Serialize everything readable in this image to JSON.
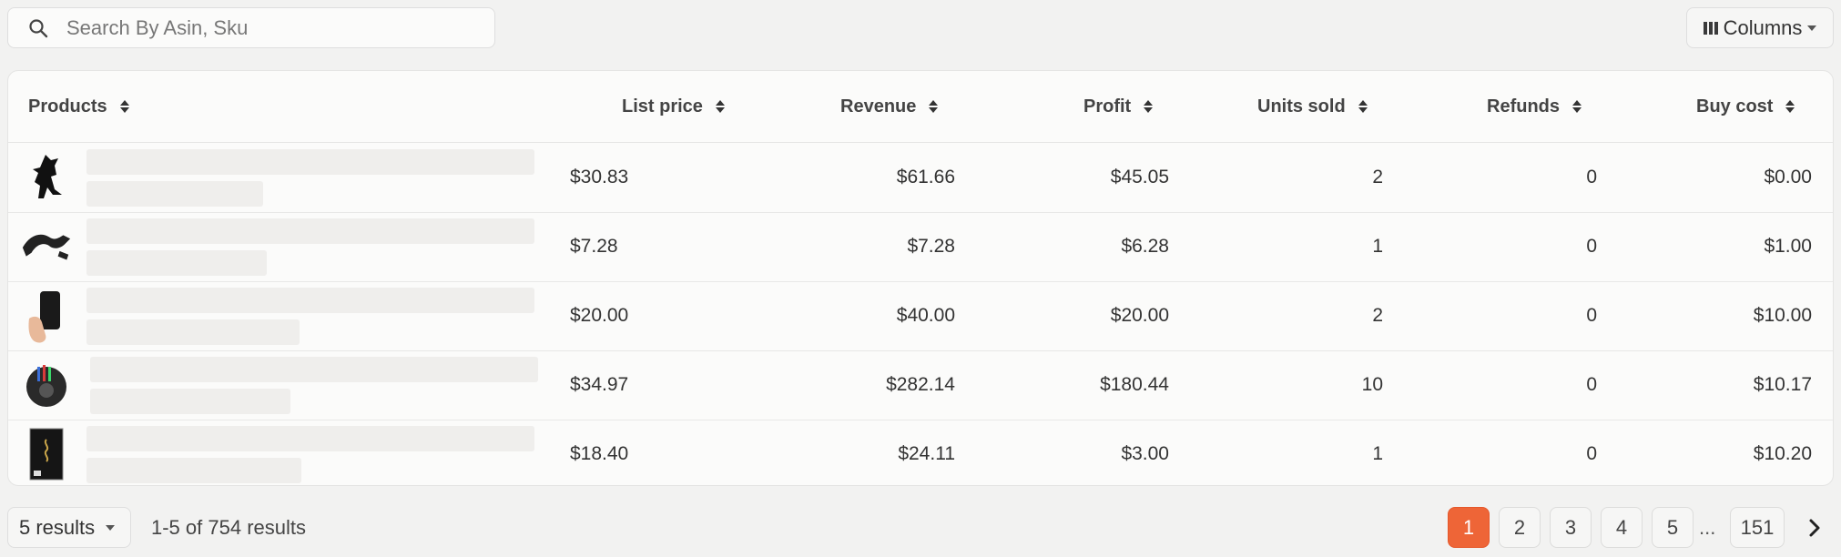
{
  "search": {
    "placeholder": "Search By Asin, Sku",
    "value": ""
  },
  "toolbar": {
    "columns_label": "Columns"
  },
  "table": {
    "headers": {
      "products": "Products",
      "list_price": "List price",
      "revenue": "Revenue",
      "profit": "Profit",
      "units_sold": "Units sold",
      "refunds": "Refunds",
      "buy_cost": "Buy cost"
    },
    "rows": [
      {
        "list_price": "$30.83",
        "revenue": "$61.66",
        "profit": "$45.05",
        "units_sold": "2",
        "refunds": "0",
        "buy_cost": "$0.00"
      },
      {
        "list_price": "$7.28",
        "revenue": "$7.28",
        "profit": "$6.28",
        "units_sold": "1",
        "refunds": "0",
        "buy_cost": "$1.00"
      },
      {
        "list_price": "$20.00",
        "revenue": "$40.00",
        "profit": "$20.00",
        "units_sold": "2",
        "refunds": "0",
        "buy_cost": "$10.00"
      },
      {
        "list_price": "$34.97",
        "revenue": "$282.14",
        "profit": "$180.44",
        "units_sold": "10",
        "refunds": "0",
        "buy_cost": "$10.17"
      },
      {
        "list_price": "$18.40",
        "revenue": "$24.11",
        "profit": "$3.00",
        "units_sold": "1",
        "refunds": "0",
        "buy_cost": "$10.20"
      }
    ]
  },
  "footer": {
    "per_page_label": "5 results",
    "summary": "1-5 of 754 results",
    "pages": [
      "1",
      "2",
      "3",
      "4",
      "5"
    ],
    "ellipsis": "...",
    "last_page": "151"
  },
  "colors": {
    "active_page": "#ee6537"
  }
}
